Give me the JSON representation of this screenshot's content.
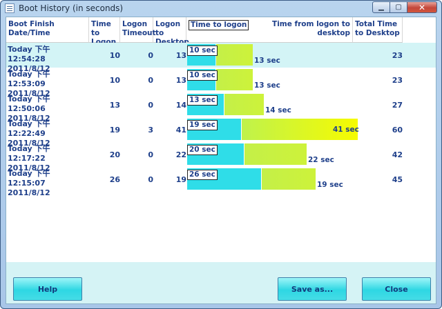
{
  "window": {
    "title": "Boot History (in seconds)"
  },
  "headers": {
    "date": "Boot Finish Date/Time",
    "logon": "Time to Logon",
    "timeout": "Logon Timeout",
    "desktop": "Logon to Desktop",
    "time_to_logon": "Time to logon",
    "from_logon": "Time from logon to desktop",
    "total": "Total Time to Desktop"
  },
  "rows": [
    {
      "day": "Today  下午  12:54:28",
      "date": "2011/8/12",
      "logon": 10,
      "timeout": 0,
      "desktop": 13,
      "total": 23,
      "logon_label": "10 sec",
      "desktop_label": "13 sec"
    },
    {
      "day": "Today  下午  12:53:09",
      "date": "2011/8/12",
      "logon": 10,
      "timeout": 0,
      "desktop": 13,
      "total": 23,
      "logon_label": "10 sec",
      "desktop_label": "13 sec"
    },
    {
      "day": "Today  下午  12:50:06",
      "date": "2011/8/12",
      "logon": 13,
      "timeout": 0,
      "desktop": 14,
      "total": 27,
      "logon_label": "13 sec",
      "desktop_label": "14 sec"
    },
    {
      "day": "Today  下午  12:22:49",
      "date": "2011/8/12",
      "logon": 19,
      "timeout": 3,
      "desktop": 41,
      "total": 60,
      "logon_label": "19 sec",
      "desktop_label": "41 sec"
    },
    {
      "day": "Today  下午  12:17:22",
      "date": "2011/8/12",
      "logon": 20,
      "timeout": 0,
      "desktop": 22,
      "total": 42,
      "logon_label": "20 sec",
      "desktop_label": "22 sec"
    },
    {
      "day": "Today  下午  12:15:07",
      "date": "2011/8/12",
      "logon": 26,
      "timeout": 0,
      "desktop": 19,
      "total": 45,
      "logon_label": "26 sec",
      "desktop_label": "19 sec"
    }
  ],
  "selected_row": 0,
  "buttons": {
    "help": "Help",
    "save": "Save as...",
    "close": "Close"
  },
  "colors": {
    "logon_bar": "#2fdde8",
    "desktop_bar": "#c4f048",
    "accent_text": "#1e3f8a"
  }
}
